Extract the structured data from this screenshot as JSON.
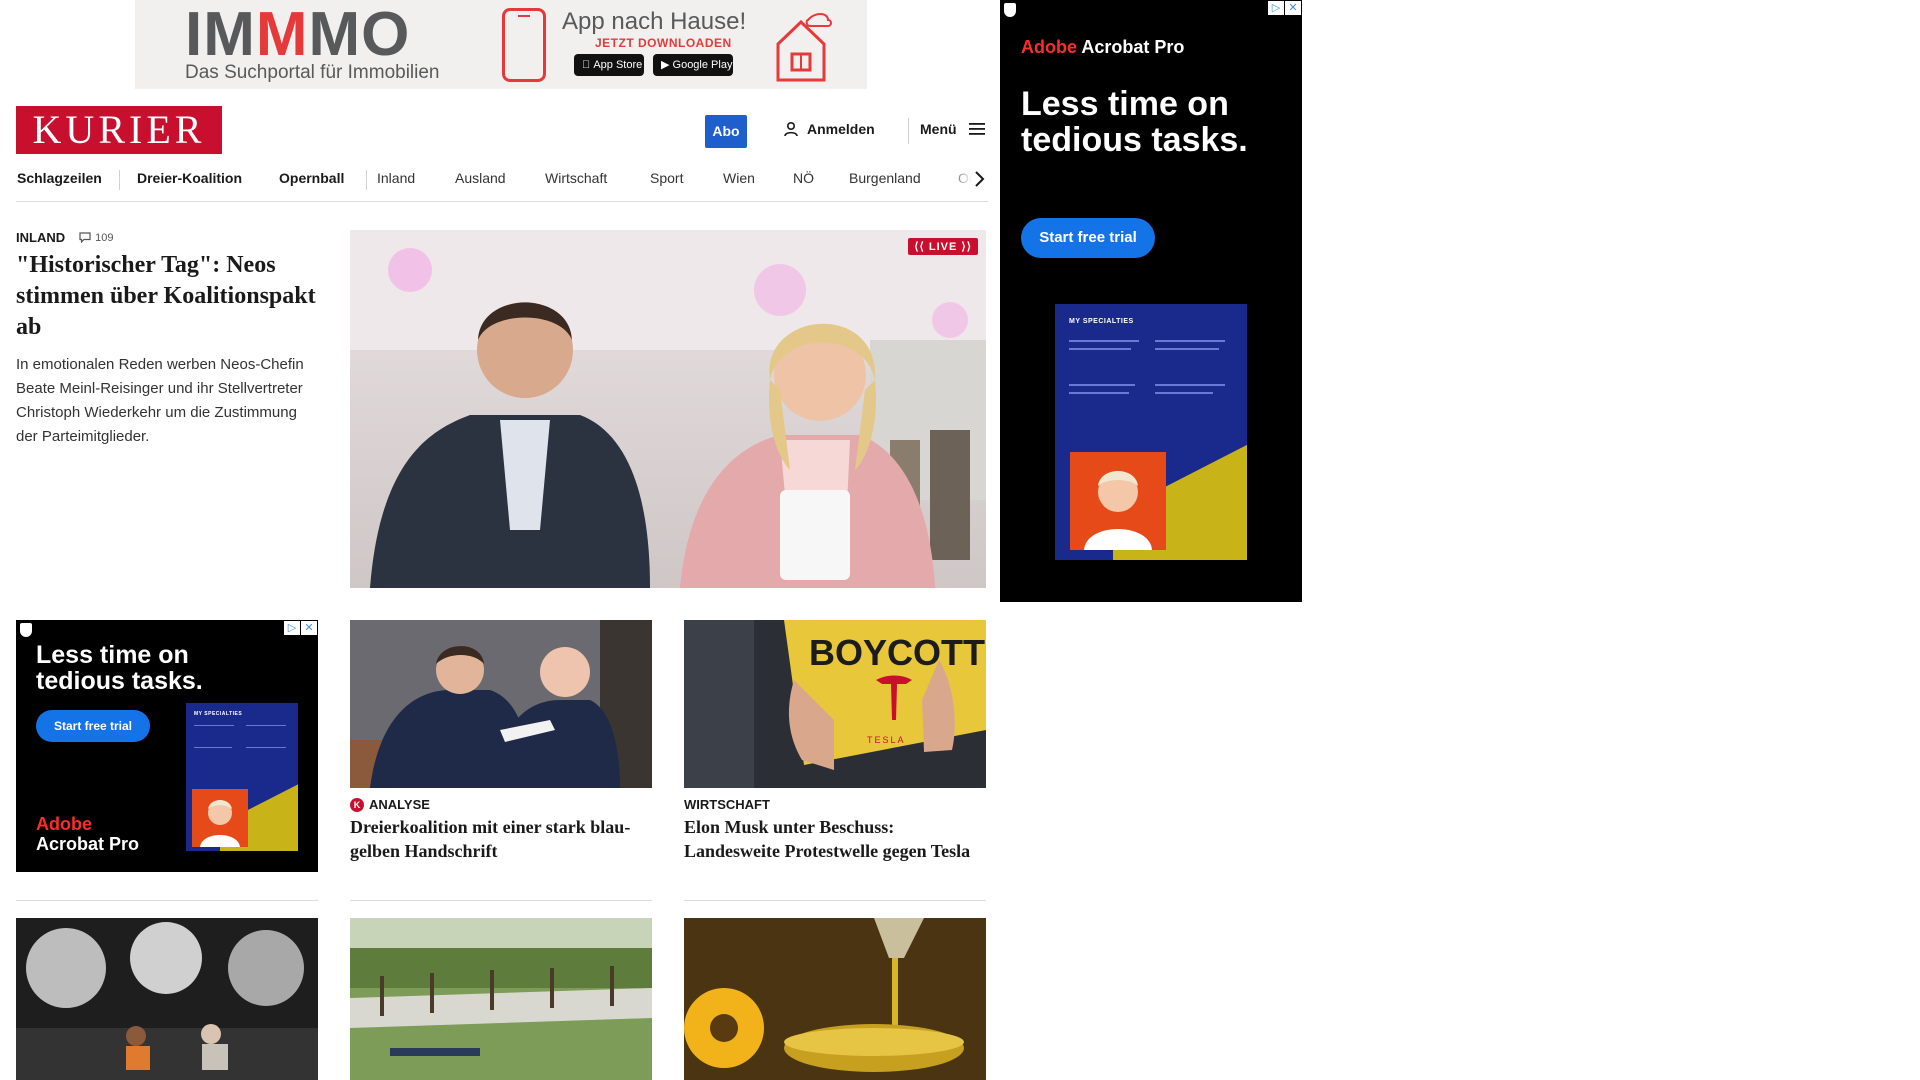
{
  "top_ad": {
    "logo_im": "IM",
    "logo_m": "M",
    "logo_mo": "MO",
    "tagline": "Das Suchportal für Immobilien",
    "title": "App nach Hause!",
    "download": "JETZT DOWNLOADEN",
    "app_store": "App Store",
    "google_play": "Google Play"
  },
  "header": {
    "logo": "KURIER",
    "abo": "Abo",
    "login": "Anmelden",
    "menu": "Menü"
  },
  "nav": {
    "items": [
      "Schlagzeilen",
      "Dreier-Koalition",
      "Opernball",
      "Inland",
      "Ausland",
      "Wirtschaft",
      "Sport",
      "Wien",
      "NÖ",
      "Burgenland",
      "Oö"
    ]
  },
  "lead": {
    "category": "INLAND",
    "comments": "109",
    "title": "\"Historischer Tag\": Neos stimmen über Koalitionspakt ab",
    "teaser": "In emotionalen Reden werben Neos-Chefin Beate Meinl-Reisinger und ihr Stellvertreter Christoph Wiederkehr um die Zustimmung der Parteimitglieder.",
    "live": "LIVE"
  },
  "cards": [
    {
      "category": "ANALYSE",
      "title": "Dreierkoalition mit einer stark blau-gelben Handschrift"
    },
    {
      "category": "WIRTSCHAFT",
      "title": "Elon Musk unter Beschuss: Landesweite Protestwelle gegen Tesla"
    }
  ],
  "side_ad": {
    "brand_red": "Adobe",
    "brand_white": " Acrobat Pro",
    "headline": "Less time on tedious tasks.",
    "cta": "Start free trial",
    "poster_title": "MY SPECIALTIES"
  },
  "small_ad": {
    "headline": "Less time on tedious tasks.",
    "cta": "Start free trial",
    "brand_red": "Adobe",
    "brand_white": "Acrobat Pro",
    "poster_title": "MY SPECIALTIES"
  },
  "image_text": {
    "boycott": "BOYCOTT",
    "tesla": "TESLA"
  },
  "colors": {
    "kurier_red": "#c8102e",
    "abo_blue": "#1e5fcc",
    "adobe_blue": "#1473e6",
    "ad_red": "#e63a3a"
  }
}
